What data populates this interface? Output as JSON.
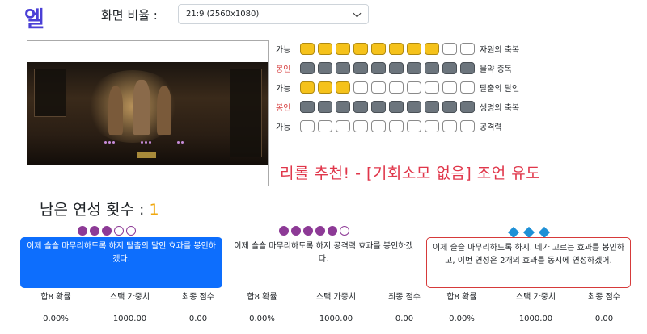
{
  "logo": "엘",
  "ratio": {
    "label": "화면 비율 :",
    "value": "21:9 (2560x1080)"
  },
  "stats": [
    {
      "status": "가능",
      "kind": "ok",
      "boxes": [
        "y",
        "y",
        "y",
        "y",
        "y",
        "y",
        "y",
        "y",
        "e",
        "e"
      ],
      "name": "자원의 축복"
    },
    {
      "status": "봉인",
      "kind": "bad",
      "boxes": [
        "g",
        "g",
        "g",
        "g",
        "g",
        "g",
        "g",
        "g",
        "g",
        "g"
      ],
      "name": "물약 중독"
    },
    {
      "status": "가능",
      "kind": "ok",
      "boxes": [
        "y",
        "y",
        "y",
        "e",
        "e",
        "e",
        "e",
        "e",
        "e",
        "e"
      ],
      "name": "탈출의 달인"
    },
    {
      "status": "봉인",
      "kind": "bad",
      "boxes": [
        "g",
        "g",
        "g",
        "g",
        "g",
        "g",
        "g",
        "g",
        "g",
        "g"
      ],
      "name": "생명의 축복"
    },
    {
      "status": "가능",
      "kind": "ok",
      "boxes": [
        "e",
        "e",
        "e",
        "e",
        "e",
        "e",
        "e",
        "e",
        "e",
        "e"
      ],
      "name": "공격력"
    }
  ],
  "recommendation": "리롤 추천! - [기회소모 없음] 조언 유도",
  "remaining": {
    "label": "남은 연성 횟수 :",
    "value": "1"
  },
  "advisors": [
    {
      "icons": [
        "cf",
        "cf",
        "cf",
        "co",
        "co"
      ],
      "message": "이제 슬슬 마무리하도록 하지.탈출의 달인 효과를 봉인하겠다.",
      "style": "blue"
    },
    {
      "icons": [
        "cf",
        "cf",
        "cf",
        "cf",
        "cf",
        "co"
      ],
      "message": "이제 슬슬 마무리하도록 하지.공격력 효과를 봉인하겠다.",
      "style": "plain"
    },
    {
      "icons": [
        "d",
        "d",
        "d"
      ],
      "message": "이제 슬슬 마무리하도록 하지. 네가 고르는 효과를 봉인하고, 이번 연성은 2개의 효과를 동시에 연성하겠어.",
      "style": "red"
    }
  ],
  "stat_headers": [
    "합8 확률",
    "스택 가중치",
    "최종 점수"
  ],
  "stat_values": [
    [
      "0.00%",
      "1000.00",
      "0.00"
    ],
    [
      "0.00%",
      "1000.00",
      "0.00"
    ],
    [
      "0.00%",
      "1000.00",
      "0.00"
    ]
  ],
  "colors": {
    "yellow": "#f5c21b",
    "gray": "#6c757d",
    "accent": "#0d6efd",
    "red": "#d63a3a",
    "purple": "#8d3a96",
    "diamond": "#1e90d6",
    "count": "#f0a810"
  }
}
